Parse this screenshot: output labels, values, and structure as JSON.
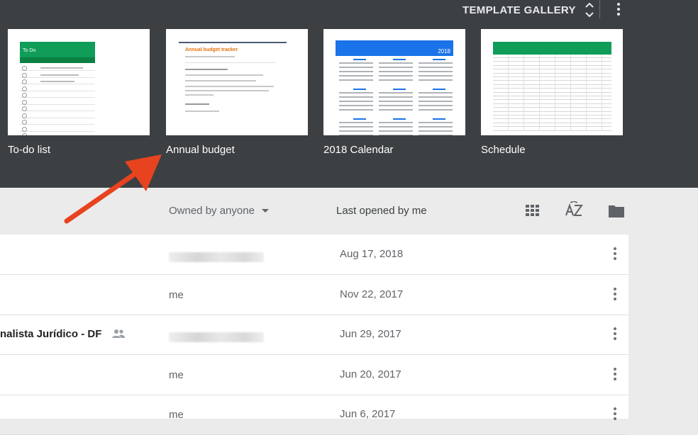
{
  "header": {
    "gallery_label": "TEMPLATE GALLERY"
  },
  "templates": [
    {
      "label": "To-do list",
      "thumb_title": "To Do"
    },
    {
      "label": "Annual budget",
      "thumb_title": "Annual budget tracker"
    },
    {
      "label": "2018 Calendar",
      "thumb_title": "2018"
    },
    {
      "label": "Schedule",
      "thumb_title": ""
    }
  ],
  "list_header": {
    "owner_filter": "Owned by anyone",
    "sort_label": "Last opened by me",
    "icons": [
      "grid-view-icon",
      "sort-az-icon",
      "folder-icon"
    ]
  },
  "rows": [
    {
      "name": "",
      "owner": "",
      "owner_blurred": true,
      "date": "Aug 17, 2018",
      "shared": false
    },
    {
      "name": "",
      "owner": "me",
      "owner_blurred": false,
      "date": "Nov 22, 2017",
      "shared": false
    },
    {
      "name": "nalista Jurídico - DF",
      "owner": "",
      "owner_blurred": true,
      "date": "Jun 29, 2017",
      "shared": true
    },
    {
      "name": "",
      "owner": "me",
      "owner_blurred": false,
      "date": "Jun 20, 2017",
      "shared": false
    },
    {
      "name": "",
      "owner": "me",
      "owner_blurred": false,
      "date": "Jun 6, 2017",
      "shared": false
    }
  ],
  "colors": {
    "header_bg": "#3c4043",
    "arrow": "#e8431f",
    "todo_green": "#0f9d58",
    "calendar_blue": "#1a73e8"
  }
}
